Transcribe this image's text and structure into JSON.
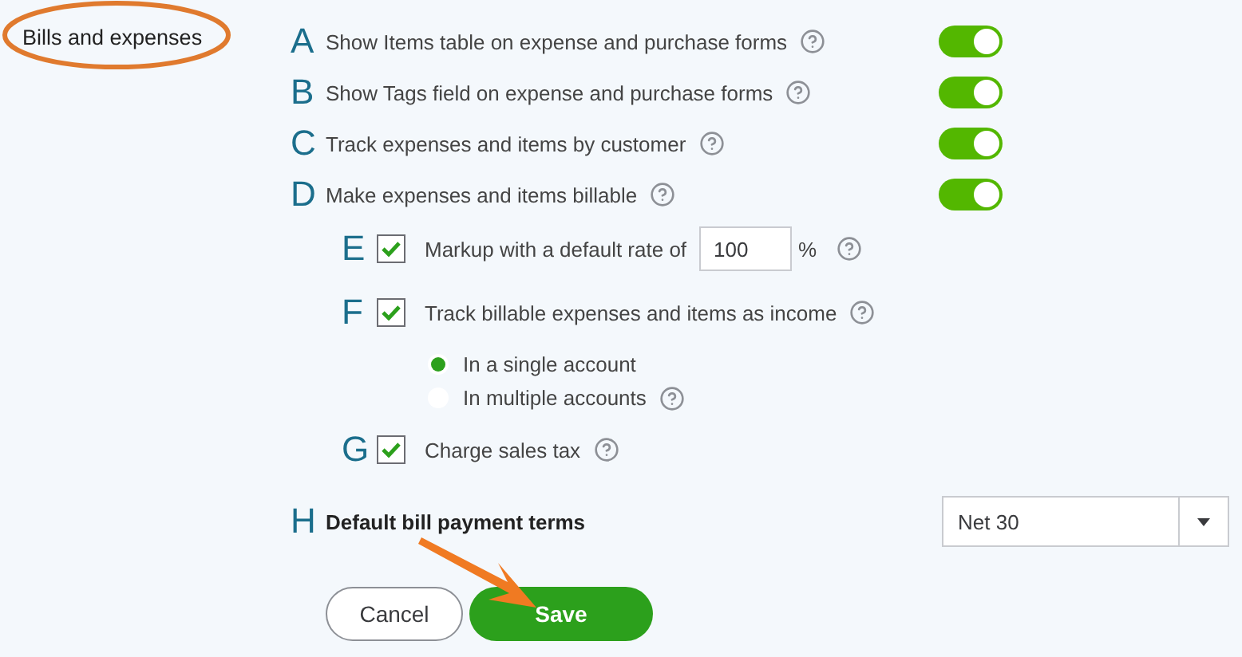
{
  "section_label": "Bills and expenses",
  "toggles": [
    {
      "marker": "A",
      "label": "Show Items table on expense and purchase forms",
      "on": true
    },
    {
      "marker": "B",
      "label": "Show Tags field on expense and purchase forms",
      "on": true
    },
    {
      "marker": "C",
      "label": "Track expenses and items by customer",
      "on": true
    },
    {
      "marker": "D",
      "label": "Make expenses and items billable",
      "on": true
    }
  ],
  "markup": {
    "marker": "E",
    "label": "Markup with a default rate of",
    "checked": true,
    "value": "100",
    "suffix": "%"
  },
  "track_income": {
    "marker": "F",
    "label": "Track billable expenses and items as income",
    "checked": true,
    "options": [
      {
        "label": "In a single account",
        "selected": true,
        "help": false
      },
      {
        "label": "In multiple accounts",
        "selected": false,
        "help": true
      }
    ]
  },
  "sales_tax": {
    "marker": "G",
    "label": "Charge sales tax",
    "checked": true
  },
  "payment_terms": {
    "marker": "H",
    "label": "Default bill payment terms",
    "value": "Net 30"
  },
  "buttons": [
    {
      "label": "Cancel",
      "kind": "secondary"
    },
    {
      "label": "Save",
      "kind": "primary"
    }
  ]
}
